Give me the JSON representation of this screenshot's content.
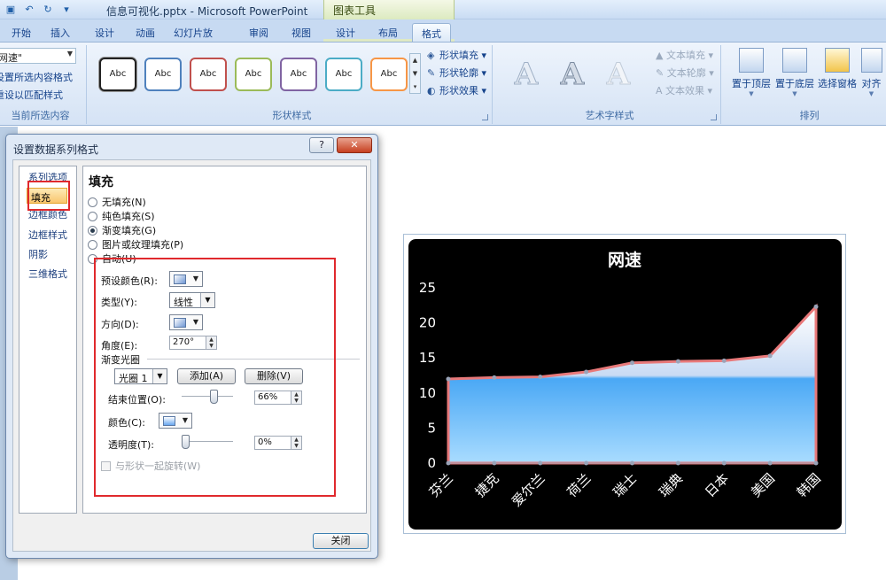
{
  "window": {
    "title": "信息可视化.pptx - Microsoft PowerPoint",
    "context_tab_group": "图表工具"
  },
  "tabs": [
    "开始",
    "插入",
    "设计",
    "动画",
    "幻灯片放映",
    "审阅",
    "视图",
    "设计",
    "布局",
    "格式"
  ],
  "active_tab": "格式",
  "ribbon": {
    "current_selection": {
      "combo_value": "网速\"",
      "link1": "设置所选内容格式",
      "link2": "重设以匹配样式",
      "label": "当前所选内容"
    },
    "shape_styles": {
      "swatch_text": "Abc",
      "swatch_colors": [
        "#222222",
        "#4f81bd",
        "#c0504d",
        "#9bbb59",
        "#8064a2",
        "#4bacc6",
        "#f79646"
      ],
      "fill": "形状填充",
      "outline": "形状轮廓",
      "effects": "形状效果",
      "label": "形状样式"
    },
    "wordart": {
      "letter": "A",
      "text_fill": "文本填充",
      "text_outline": "文本轮廓",
      "text_effects": "文本效果",
      "label": "艺术字样式"
    },
    "arrange": {
      "bring_front": "置于顶层",
      "send_back": "置于底层",
      "selection_pane": "选择窗格",
      "align": "对齐",
      "label": "排列"
    }
  },
  "dialog": {
    "title": "设置数据系列格式",
    "help": "?",
    "nav": [
      "系列选项",
      "填充",
      "边框颜色",
      "边框样式",
      "阴影",
      "三维格式"
    ],
    "nav_selected": "填充",
    "heading": "填充",
    "fill_options": [
      {
        "label": "无填充(N)",
        "on": false
      },
      {
        "label": "纯色填充(S)",
        "on": false
      },
      {
        "label": "渐变填充(G)",
        "on": true
      },
      {
        "label": "图片或纹理填充(P)",
        "on": false
      },
      {
        "label": "自动(U)",
        "on": false
      }
    ],
    "preset_colors_label": "预设颜色(R):",
    "type_label": "类型(Y):",
    "type_value": "线性",
    "direction_label": "方向(D):",
    "angle_label": "角度(E):",
    "angle_value": "270°",
    "gradient_stops_label": "渐变光圈",
    "stop_value": "光圈 1",
    "add_button": "添加(A)",
    "delete_button": "删除(V)",
    "end_position_label": "结束位置(O):",
    "end_position_value": "66%",
    "end_position_fraction": 0.66,
    "color_label": "颜色(C):",
    "transparency_label": "透明度(T):",
    "transparency_value": "0%",
    "transparency_fraction": 0,
    "rotate_label": "与形状一起旋转(W)",
    "close_button": "关闭"
  },
  "chart_data": {
    "type": "area",
    "title": "网速",
    "categories": [
      "芬兰",
      "捷克",
      "爱尔兰",
      "荷兰",
      "瑞士",
      "瑞典",
      "日本",
      "美国",
      "韩国"
    ],
    "series": [
      {
        "values": [
          12,
          12.2,
          12.3,
          13,
          14.3,
          14.5,
          14.6,
          15.3,
          22.3
        ]
      }
    ],
    "ylim": [
      0,
      25
    ],
    "yticks": [
      0,
      5,
      10,
      15,
      20,
      25
    ],
    "grid": false,
    "legend": "none",
    "colors": {
      "background": "#000000",
      "line": "#e8797a",
      "fill_top": "#ffffff",
      "fill_mid": "#4aa8f5",
      "fill_bottom": "#a9dcff",
      "text": "#ffffff"
    }
  }
}
